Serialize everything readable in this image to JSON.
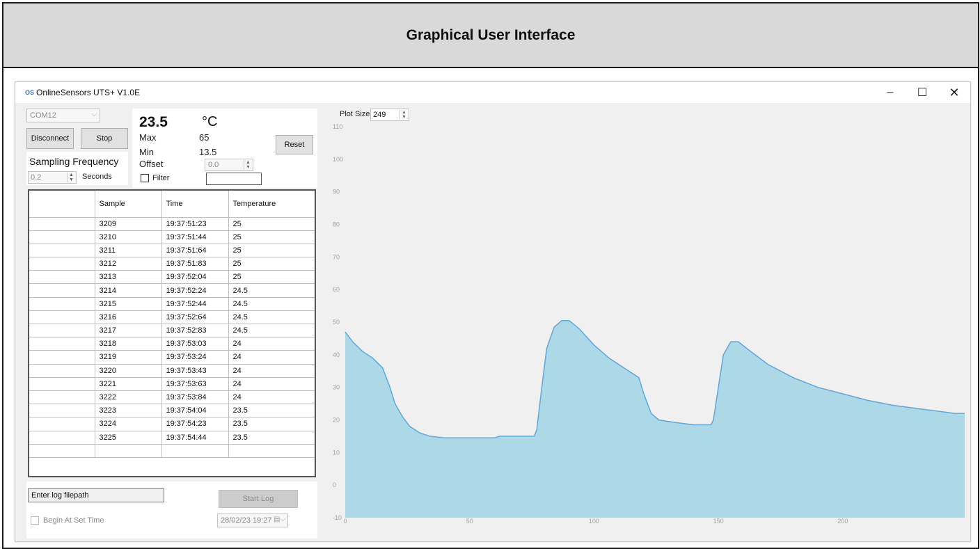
{
  "banner": {
    "title": "Graphical User Interface"
  },
  "window": {
    "title": "OnlineSensors UTS+ V1.0E",
    "icon": "OS",
    "minimize": "–",
    "maximize": "☐",
    "close": "✕"
  },
  "connection": {
    "port": "COM12",
    "disconnect_label": "Disconnect",
    "stop_label": "Stop"
  },
  "sampling": {
    "label": "Sampling Frequency",
    "value": "0.2",
    "unit": "Seconds"
  },
  "readout": {
    "temperature": "23.5",
    "unit": "°C",
    "max_label": "Max",
    "max_value": "65",
    "min_label": "Min",
    "min_value": "13.5",
    "offset_label": "Offset",
    "offset_value": "0.0",
    "filter_label": "Filter",
    "reset_label": "Reset"
  },
  "table": {
    "headers": [
      "",
      "Sample",
      "Time",
      "Temperature"
    ],
    "rows": [
      [
        "3209",
        "19:37:51:23",
        "25"
      ],
      [
        "3210",
        "19:37:51:44",
        "25"
      ],
      [
        "3211",
        "19:37:51:64",
        "25"
      ],
      [
        "3212",
        "19:37:51:83",
        "25"
      ],
      [
        "3213",
        "19:37:52:04",
        "25"
      ],
      [
        "3214",
        "19:37:52:24",
        "24.5"
      ],
      [
        "3215",
        "19:37:52:44",
        "24.5"
      ],
      [
        "3216",
        "19:37:52:64",
        "24.5"
      ],
      [
        "3217",
        "19:37:52:83",
        "24.5"
      ],
      [
        "3218",
        "19:37:53:03",
        "24"
      ],
      [
        "3219",
        "19:37:53:24",
        "24"
      ],
      [
        "3220",
        "19:37:53:43",
        "24"
      ],
      [
        "3221",
        "19:37:53:63",
        "24"
      ],
      [
        "3222",
        "19:37:53:84",
        "24"
      ],
      [
        "3223",
        "19:37:54:04",
        "23.5"
      ],
      [
        "3224",
        "19:37:54:23",
        "23.5"
      ],
      [
        "3225",
        "19:37:54:44",
        "23.5"
      ]
    ]
  },
  "log": {
    "filepath_placeholder": "Enter log filepath",
    "start_label": "Start Log",
    "begin_label": "Begin At Set Time",
    "datetime": "28/02/23 19:27"
  },
  "plot": {
    "size_label": "Plot Size",
    "size_value": "249"
  },
  "chart_data": {
    "type": "area",
    "xlim": [
      0,
      249
    ],
    "ylim": [
      -10,
      110
    ],
    "xticks": [
      0,
      50,
      100,
      150,
      200
    ],
    "yticks": [
      -10,
      0,
      10,
      20,
      30,
      40,
      50,
      60,
      70,
      80,
      90,
      100,
      110
    ],
    "grid": false,
    "fill_color": "#add8e6",
    "line_color": "#5aa8e0",
    "x": [
      0,
      3,
      7,
      11,
      15,
      18,
      20,
      23,
      26,
      30,
      34,
      40,
      48,
      56,
      60,
      62,
      70,
      76,
      77,
      79,
      81,
      84,
      87,
      90,
      94,
      100,
      106,
      112,
      118,
      120,
      123,
      126,
      130,
      135,
      140,
      142,
      147,
      148,
      150,
      152,
      155,
      158,
      163,
      170,
      180,
      190,
      200,
      210,
      220,
      230,
      240,
      245,
      249
    ],
    "y": [
      47,
      44,
      41,
      39,
      36,
      30,
      25,
      21,
      18,
      16,
      15,
      14.5,
      14.5,
      14.5,
      14.5,
      15,
      15,
      15,
      17,
      30,
      42,
      48.5,
      50.5,
      50.5,
      48,
      43,
      39,
      36,
      33,
      28,
      22,
      20,
      19.5,
      19,
      18.5,
      18.5,
      18.5,
      20,
      30,
      40,
      44,
      44,
      41,
      37,
      33,
      30,
      28,
      26,
      24.5,
      23.5,
      22.5,
      22,
      22
    ]
  }
}
